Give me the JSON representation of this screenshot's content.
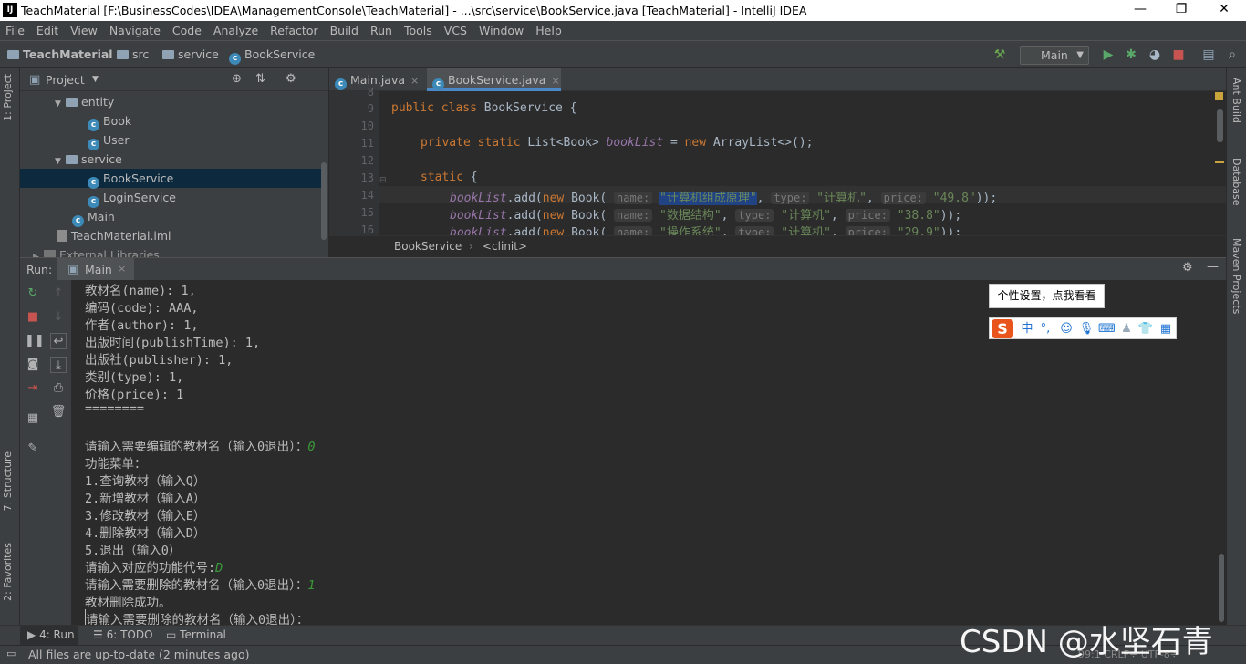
{
  "window": {
    "title": "TeachMaterial [F:\\BusinessCodes\\IDEA\\ManagementConsole\\TeachMaterial] - ...\\src\\service\\BookService.java [TeachMaterial] - IntelliJ IDEA",
    "logo": "IJ",
    "controls": [
      "minimize-icon",
      "restore-icon",
      "close-icon"
    ]
  },
  "menu": [
    "File",
    "Edit",
    "View",
    "Navigate",
    "Code",
    "Analyze",
    "Refactor",
    "Build",
    "Run",
    "Tools",
    "VCS",
    "Window",
    "Help"
  ],
  "navbar": {
    "crumbs": [
      "TeachMaterial",
      "src",
      "service",
      "BookService"
    ],
    "run_config": "Main"
  },
  "left_strip": {
    "project": "1: Project",
    "structure": "7: Structure",
    "favorites": "2: Favorites"
  },
  "right_strip": {
    "ant": "Ant Build",
    "database": "Database",
    "maven": "Maven Projects"
  },
  "project": {
    "header": "Project",
    "tree": [
      {
        "label": "entity",
        "kind": "package"
      },
      {
        "label": "Book",
        "kind": "class"
      },
      {
        "label": "User",
        "kind": "class"
      },
      {
        "label": "service",
        "kind": "package"
      },
      {
        "label": "BookService",
        "kind": "class",
        "selected": true
      },
      {
        "label": "LoginService",
        "kind": "class"
      },
      {
        "label": "Main",
        "kind": "class"
      },
      {
        "label": "TeachMaterial.iml",
        "kind": "file"
      },
      {
        "label": "External Libraries",
        "kind": "library"
      }
    ]
  },
  "editor": {
    "tabs": [
      {
        "label": "Main.java",
        "active": false
      },
      {
        "label": "BookService.java",
        "active": true
      }
    ],
    "line_numbers": [
      "8",
      "9",
      "10",
      "11",
      "12",
      "13",
      "14",
      "15",
      "16"
    ],
    "code": {
      "l9_kw": "public class",
      "l9_rest": " BookService {",
      "l11_kw": "private static",
      "l11_type": " List<Book> ",
      "l11_field": "bookList",
      "l11_eq": " = ",
      "l11_new": "new",
      "l11_rest": " ArrayList<>();",
      "l13_kw": "static",
      "l13_rest": " {",
      "books": [
        {
          "name": "\"计算机组成原理\"",
          "type": "\"计算机\"",
          "price": "\"49.8\""
        },
        {
          "name": "\"数据结构\"",
          "type": "\"计算机\"",
          "price": "\"38.8\""
        },
        {
          "name": "\"操作系统\"",
          "type": "\"计算机\"",
          "price": "\"29.9\""
        }
      ],
      "field": "bookList",
      "add_call": ".add(",
      "new_kw": "new",
      "ctor": " Book(",
      "hint_name": "name:",
      "hint_type": "type:",
      "hint_price": "price:",
      "end": "));"
    },
    "breadcrumb": [
      "BookService",
      "<clinit>"
    ]
  },
  "run": {
    "label": "Run:",
    "tab": "Main",
    "console": [
      {
        "text": "教材名(name): 1,"
      },
      {
        "text": "编码(code): AAA,"
      },
      {
        "text": "作者(author): 1,"
      },
      {
        "text": "出版时间(publishTime): 1,"
      },
      {
        "text": "出版社(publisher): 1,"
      },
      {
        "text": "类别(type): 1,"
      },
      {
        "text": "价格(price): 1"
      },
      {
        "text": "========"
      },
      {
        "text": ""
      },
      {
        "text": "请输入需要编辑的教材名（输入0退出）：",
        "input": "0"
      },
      {
        "text": "功能菜单："
      },
      {
        "text": "1.查询教材（输入Q）"
      },
      {
        "text": "2.新增教材（输入A）"
      },
      {
        "text": "3.修改教材（输入E）"
      },
      {
        "text": "4.删除教材（输入D）"
      },
      {
        "text": "5.退出（输入0）"
      },
      {
        "text": "请输入对应的功能代号:",
        "input": "D"
      },
      {
        "text": "请输入需要删除的教材名（输入0退出）：",
        "input": "1"
      },
      {
        "text": "教材删除成功。"
      },
      {
        "text": "请输入需要删除的教材名（输入0退出）："
      }
    ]
  },
  "ime": {
    "tooltip": "个性设置，点我看看",
    "mode": "中",
    "punct": "°,"
  },
  "bottom_tabs": [
    "4: Run",
    "6: TODO",
    "Terminal"
  ],
  "status": {
    "message": "All files are up-to-date (2 minutes ago)",
    "right": "99:1  CRLF÷  UTF-8÷"
  },
  "watermark": "CSDN @水坚石青",
  "colors": {
    "background": "#2b2b2b",
    "panel": "#3c3f41",
    "keyword": "#cc7832",
    "string": "#6a8759",
    "field": "#9876aa",
    "selection": "#0d293e",
    "user_input": "#3a9a3a"
  }
}
